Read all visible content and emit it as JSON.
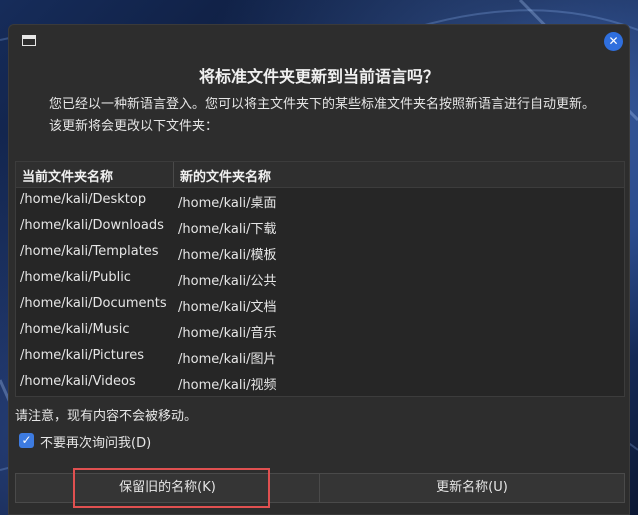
{
  "dialog": {
    "heading": "将标准文件夹更新到当前语言吗？",
    "description": "您已经以一种新语言登入。您可以将主文件夹下的某些标准文件夹名按照新语言进行自动更新。该更新将会更改以下文件夹："
  },
  "table": {
    "headers": [
      "当前文件夹名称",
      "新的文件夹名称"
    ],
    "rows": [
      {
        "current": "/home/kali/Desktop",
        "new": "/home/kali/桌面"
      },
      {
        "current": "/home/kali/Downloads",
        "new": "/home/kali/下载"
      },
      {
        "current": "/home/kali/Templates",
        "new": "/home/kali/模板"
      },
      {
        "current": "/home/kali/Public",
        "new": "/home/kali/公共"
      },
      {
        "current": "/home/kali/Documents",
        "new": "/home/kali/文档"
      },
      {
        "current": "/home/kali/Music",
        "new": "/home/kali/音乐"
      },
      {
        "current": "/home/kali/Pictures",
        "new": "/home/kali/图片"
      },
      {
        "current": "/home/kali/Videos",
        "new": "/home/kali/视频"
      }
    ]
  },
  "note": "请注意，现有内容不会被移动。",
  "checkbox": {
    "label": "不要再次询问我(D)",
    "checked": true,
    "glyph": "✓"
  },
  "buttons": {
    "keep": "保留旧的名称(K)",
    "update": "更新名称(U)"
  },
  "titlebar": {
    "close_glyph": "✕",
    "window_icon": "window-icon"
  },
  "colors": {
    "accent": "#2f6fde",
    "highlight": "#e05050",
    "background": "#2d2d2d"
  }
}
